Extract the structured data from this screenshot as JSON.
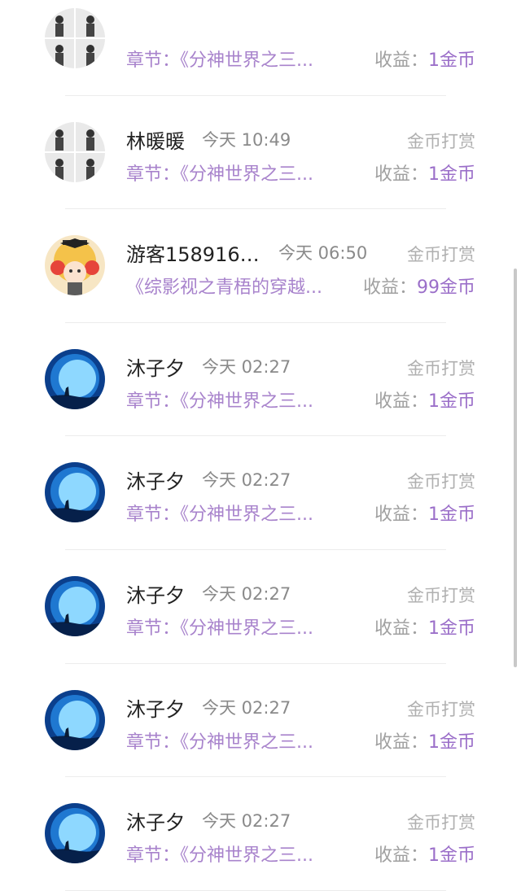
{
  "rewards": [
    {
      "avatar": "photo-grid-avatar",
      "name": "",
      "time": "",
      "type": "",
      "chapter": "章节：《分神世界之三...",
      "earn_label": "收益：",
      "earn_value": "1金币"
    },
    {
      "avatar": "photo-grid-avatar",
      "name": "林暖暖",
      "time": "今天 10:49",
      "type": "金币打赏",
      "chapter": "章节：《分神世界之三...",
      "earn_label": "收益：",
      "earn_value": "1金币"
    },
    {
      "avatar": "cartoon-avatar",
      "name": "游客1589161...",
      "time": "今天 06:50",
      "type": "金币打赏",
      "chapter": "《综影视之青梧的穿越...",
      "earn_label": "收益：",
      "earn_value": "99金币"
    },
    {
      "avatar": "moon-avatar",
      "name": "沐子夕",
      "time": "今天 02:27",
      "type": "金币打赏",
      "chapter": "章节：《分神世界之三...",
      "earn_label": "收益：",
      "earn_value": "1金币"
    },
    {
      "avatar": "moon-avatar",
      "name": "沐子夕",
      "time": "今天 02:27",
      "type": "金币打赏",
      "chapter": "章节：《分神世界之三...",
      "earn_label": "收益：",
      "earn_value": "1金币"
    },
    {
      "avatar": "moon-avatar",
      "name": "沐子夕",
      "time": "今天 02:27",
      "type": "金币打赏",
      "chapter": "章节：《分神世界之三...",
      "earn_label": "收益：",
      "earn_value": "1金币"
    },
    {
      "avatar": "moon-avatar",
      "name": "沐子夕",
      "time": "今天 02:27",
      "type": "金币打赏",
      "chapter": "章节：《分神世界之三...",
      "earn_label": "收益：",
      "earn_value": "1金币"
    },
    {
      "avatar": "moon-avatar",
      "name": "沐子夕",
      "time": "今天 02:27",
      "type": "金币打赏",
      "chapter": "章节：《分神世界之三...",
      "earn_label": "收益：",
      "earn_value": "1金币"
    }
  ],
  "colors": {
    "accent": "#9b6fc9",
    "chapter": "#a883cc",
    "muted": "#b0b0b0"
  }
}
